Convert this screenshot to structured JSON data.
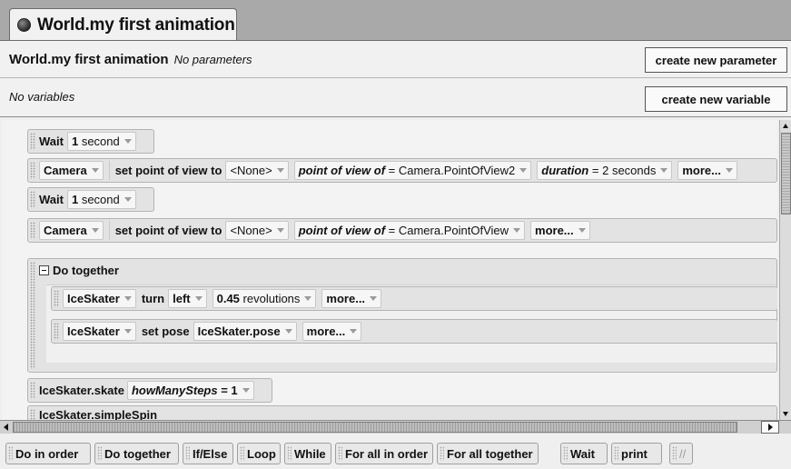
{
  "tab": {
    "title": "World.my first animation"
  },
  "header": {
    "method_title": "World.my first animation",
    "params_text": "No parameters",
    "create_param_label": "create new parameter",
    "vars_text": "No variables",
    "create_var_label": "create new variable"
  },
  "code": {
    "wait1": {
      "keyword": "Wait",
      "amount": "1",
      "unit": "second"
    },
    "cam1": {
      "object": "Camera",
      "method": "set point of view to",
      "target": "<None>",
      "pov_label": "point of view of",
      "pov_value": "= Camera.PointOfView2",
      "duration_label": "duration",
      "duration_value": "= 2",
      "duration_unit": "seconds",
      "more": "more..."
    },
    "wait2": {
      "keyword": "Wait",
      "amount": "1",
      "unit": "second"
    },
    "cam2": {
      "object": "Camera",
      "method": "set point of view to",
      "target": "<None>",
      "pov_label": "point of view of",
      "pov_value": "= Camera.PointOfView",
      "more": "more..."
    },
    "dotogether": {
      "label": "Do together",
      "turn": {
        "object": "IceSkater",
        "method": "turn",
        "direction": "left",
        "amount": "0.45",
        "unit": "revolutions",
        "more": "more..."
      },
      "pose": {
        "object": "IceSkater",
        "method": "set pose",
        "value": "IceSkater.pose",
        "more": "more..."
      }
    },
    "skate": {
      "call": "IceSkater.skate",
      "param_label": "howManySteps",
      "param_value": "= 1"
    },
    "spin": {
      "call": "IceSkater.simpleSpin"
    }
  },
  "palette": {
    "items": [
      "Do in order",
      "Do together",
      "If/Else",
      "Loop",
      "While",
      "For all in order",
      "For all together",
      "Wait",
      "print",
      "//"
    ]
  }
}
